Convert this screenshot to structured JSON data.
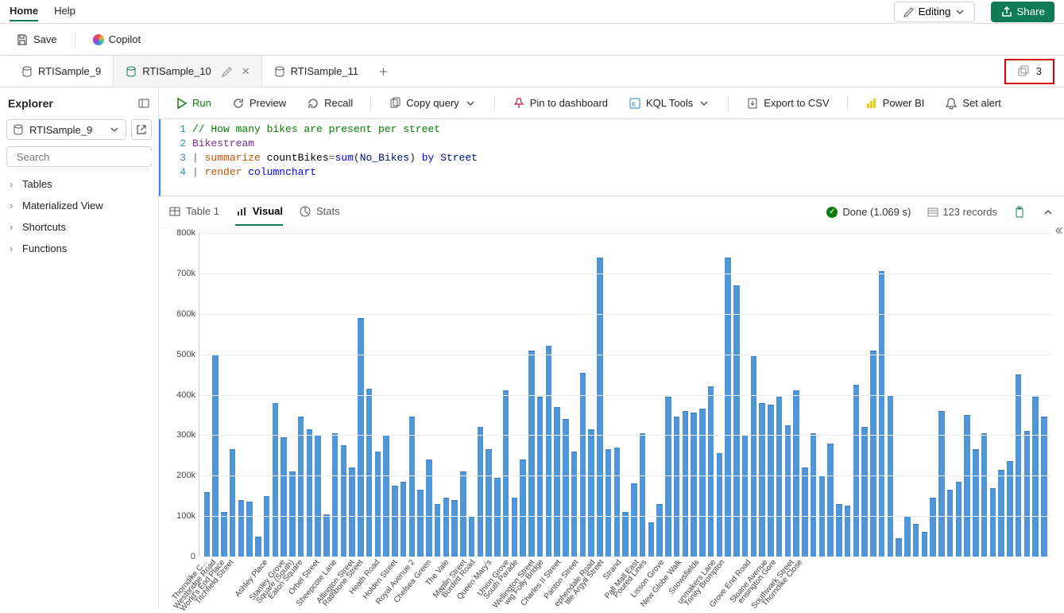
{
  "menubar": {
    "home": "Home",
    "help": "Help",
    "editing": "Editing",
    "share": "Share"
  },
  "toolbar1": {
    "save": "Save",
    "copilot": "Copilot"
  },
  "tabs": {
    "items": [
      {
        "label": "RTISample_9"
      },
      {
        "label": "RTISample_10"
      },
      {
        "label": "RTISample_11"
      }
    ],
    "count": "3"
  },
  "sidebar": {
    "title": "Explorer",
    "db": "RTISample_9",
    "search": "Search",
    "tree": [
      "Tables",
      "Materialized View",
      "Shortcuts",
      "Functions"
    ]
  },
  "qtoolbar": {
    "run": "Run",
    "preview": "Preview",
    "recall": "Recall",
    "copy": "Copy query",
    "pin": "Pin to dashboard",
    "kql": "KQL Tools",
    "csv": "Export to CSV",
    "pbi": "Power BI",
    "alert": "Set alert"
  },
  "editor": {
    "lines": [
      "1",
      "2",
      "3",
      "4"
    ],
    "comment": "// How many bikes are present per street",
    "table": "Bikestream",
    "l3_summarize": "summarize",
    "l3_countBikes": "countBikes",
    "l3_eq": "=",
    "l3_sum": "sum",
    "l3_open": "(",
    "l3_col": "No_Bikes",
    "l3_close": ")",
    "l3_by": " by ",
    "l3_street": "Street",
    "l4_render": "render",
    "l4_chart": "columnchart"
  },
  "results": {
    "tabs": {
      "table": "Table 1",
      "visual": "Visual",
      "stats": "Stats"
    },
    "status": "Done (1.069 s)",
    "records": "123 records"
  },
  "chart_data": {
    "type": "bar",
    "ylabel": "",
    "xlabel": "",
    "ylim": [
      0,
      800000
    ],
    "yticks": [
      "0",
      "100k",
      "200k",
      "300k",
      "400k",
      "500k",
      "600k",
      "700k",
      "800k"
    ],
    "categories": [
      "Thorndike C...",
      "Westbridge Road",
      "World's End Place",
      "Titchfield Street",
      "",
      "",
      "",
      "Ashley Place",
      "",
      "Stanley Grove",
      "Square (South)",
      "Eaton Square",
      "",
      "Orbel Street",
      "",
      "Sheepcote Lane",
      "",
      "Allington Street",
      "Rathbone Street",
      "",
      "Heath Road",
      "",
      "Holden Street",
      "",
      "Royal Avenue 2",
      "",
      "Chelsea Green",
      "",
      "The Vale",
      "",
      "Maplin Street",
      "Burdett Road",
      "",
      "Queen Mary's",
      "",
      "Union Grove",
      "South Parade",
      "",
      "Wellington Street",
      "wig Folly Bridge",
      "",
      "Charles II Street",
      "",
      "Panton Street",
      "",
      "ephendale Road",
      "ttle Argyll Street",
      "",
      "Strand",
      "",
      "Pall Mall East",
      "Poured Lines",
      "",
      "Lisson Grove",
      "",
      "New Globe Walk",
      "",
      "Snowsfields",
      "",
      "unmakers Lane",
      "Trinity Brompton",
      "",
      "",
      "Grove End Road",
      "",
      "Sloane Avenue",
      "ensington Gore",
      "",
      "Southwark Street",
      "Thorndike Close"
    ],
    "values": [
      160000,
      500000,
      110000,
      265000,
      140000,
      135000,
      50000,
      150000,
      380000,
      295000,
      210000,
      345000,
      315000,
      300000,
      105000,
      305000,
      275000,
      220000,
      590000,
      415000,
      260000,
      300000,
      175000,
      185000,
      345000,
      165000,
      240000,
      130000,
      145000,
      140000,
      210000,
      100000,
      320000,
      265000,
      195000,
      410000,
      145000,
      240000,
      510000,
      395000,
      520000,
      370000,
      340000,
      260000,
      455000,
      315000,
      740000,
      265000,
      270000,
      110000,
      180000,
      305000,
      85000,
      130000,
      395000,
      345000,
      360000,
      355000,
      365000,
      420000,
      255000,
      740000,
      670000,
      300000,
      495000,
      380000,
      375000,
      395000,
      325000,
      410000,
      220000,
      305000,
      200000,
      280000,
      130000,
      125000,
      425000,
      320000,
      510000,
      705000,
      400000,
      45000,
      100000,
      80000,
      60000,
      145000,
      360000,
      165000,
      185000,
      350000,
      265000,
      305000,
      170000,
      215000,
      235000,
      450000,
      310000,
      395000,
      345000
    ],
    "label_indices": [
      0,
      1,
      2,
      3,
      7,
      9,
      10,
      11,
      13,
      15,
      17,
      18,
      20,
      22,
      24,
      26,
      28,
      30,
      31,
      33,
      35,
      36,
      38,
      39,
      41,
      43,
      45,
      46,
      48,
      50,
      51,
      53,
      55,
      57,
      59,
      60,
      63,
      65,
      66,
      68,
      69
    ]
  }
}
